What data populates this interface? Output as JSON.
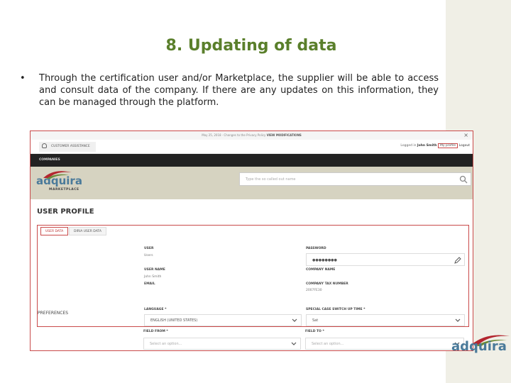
{
  "slide": {
    "title": "8. Updating of data",
    "bullet_text": "Through the certification user and/or Marketplace, the supplier will be able to access and consult data of the company. If there are any updates on this information, they can be managed through the platform."
  },
  "screenshot": {
    "notice": {
      "text": "May 25, 2018 · Changes to the Privacy Policy",
      "link": "VIEW MODIFICATIONS",
      "close": "×"
    },
    "topbar": {
      "customer_assistance": "CUSTOMER ASSISTANCE",
      "logged_in_prefix": "Logged in",
      "user_name": "John Smith",
      "my_profile": "My profile",
      "logout": "Logout"
    },
    "navbar": {
      "item": "COMPANIES"
    },
    "brand": {
      "logo_word": "adquira",
      "logo_sub": "MARKETPLACE",
      "search_placeholder": "Type the so called out name"
    },
    "page_title": "USER PROFILE",
    "tabs": [
      {
        "label": "USER DATA",
        "active": true
      },
      {
        "label": "DIRIA USER DATA",
        "active": false
      }
    ],
    "fields": {
      "user_label": "USER",
      "user_value": "Users",
      "password_label": "PASSWORD",
      "password_value": "●●●●●●●●",
      "username_label": "USER NAME",
      "username_value": "John Smith",
      "company_name_label": "COMPANY NAME",
      "email_label": "EMAIL",
      "company_tax_label": "COMPANY TAX NUMBER",
      "company_tax_value": "2007FE30"
    },
    "preferences": {
      "section_label": "PREFERENCES",
      "language_label": "LANGUAGE *",
      "language_value": "ENGLISH (UNITED STATES)",
      "spelling_label": "SPECIAL CASE SWITCH UP TIME *",
      "spelling_value": "Sat",
      "field3_label": "FIELD FROM *",
      "field3_placeholder": "Select an option...",
      "field4_label": "FIELD TO *",
      "field4_placeholder": "Select an option..."
    }
  },
  "corner_logo": {
    "word": "adquira"
  },
  "colors": {
    "title": "#5a7f2b",
    "highlight": "#c94a4a",
    "brand_blue": "#4a7a9a",
    "accent_red": "#b3262f"
  }
}
